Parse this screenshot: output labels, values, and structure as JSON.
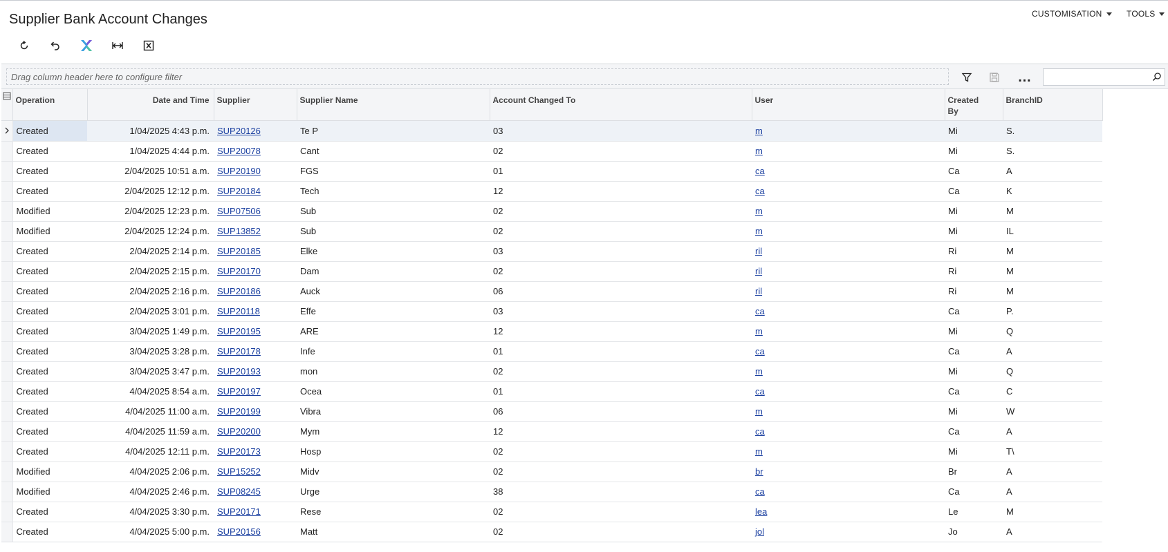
{
  "page": {
    "title": "Supplier Bank Account Changes",
    "menus": [
      {
        "label": "CUSTOMISATION"
      },
      {
        "label": "TOOLS"
      }
    ]
  },
  "toolbar": {
    "buttons": [
      {
        "icon": "refresh-icon"
      },
      {
        "icon": "undo-icon"
      },
      {
        "icon": "fit-columns-icon"
      },
      {
        "icon": "column-width-icon"
      },
      {
        "icon": "export-excel-icon"
      }
    ]
  },
  "filter": {
    "placeholder": "Drag column header here to configure filter",
    "search_value": ""
  },
  "grid": {
    "columns": [
      {
        "key": "operation",
        "label": "Operation"
      },
      {
        "key": "datetime",
        "label": "Date and Time"
      },
      {
        "key": "supplier",
        "label": "Supplier"
      },
      {
        "key": "supplier_name",
        "label": "Supplier Name"
      },
      {
        "key": "account",
        "label": "Account Changed To"
      },
      {
        "key": "user",
        "label": "User"
      },
      {
        "key": "created_by",
        "label": "Created By"
      },
      {
        "key": "branch",
        "label": "BranchID"
      }
    ],
    "rows": [
      {
        "operation": "Created",
        "datetime": "1/04/2025 4:43 p.m.",
        "supplier": "SUP20126",
        "supplier_name": "Te P",
        "account": "03",
        "user": "m",
        "created_by": "Mi",
        "branch": "S."
      },
      {
        "operation": "Created",
        "datetime": "1/04/2025 4:44 p.m.",
        "supplier": "SUP20078",
        "supplier_name": "Cant",
        "account": "02",
        "user": "m",
        "created_by": "Mi",
        "branch": "S."
      },
      {
        "operation": "Created",
        "datetime": "2/04/2025 10:51 a.m.",
        "supplier": "SUP20190",
        "supplier_name": "FGS",
        "account": "01",
        "user": "ca",
        "created_by": "Ca",
        "branch": "A"
      },
      {
        "operation": "Created",
        "datetime": "2/04/2025 12:12 p.m.",
        "supplier": "SUP20184",
        "supplier_name": "Tech",
        "account": "12",
        "user": "ca",
        "created_by": "Ca",
        "branch": "K"
      },
      {
        "operation": "Modified",
        "datetime": "2/04/2025 12:23 p.m.",
        "supplier": "SUP07506",
        "supplier_name": "Sub",
        "account": "02",
        "user": "m",
        "created_by": "Mi",
        "branch": "M"
      },
      {
        "operation": "Modified",
        "datetime": "2/04/2025 12:24 p.m.",
        "supplier": "SUP13852",
        "supplier_name": "Sub",
        "account": "02",
        "user": "m",
        "created_by": "Mi",
        "branch": "IL"
      },
      {
        "operation": "Created",
        "datetime": "2/04/2025 2:14 p.m.",
        "supplier": "SUP20185",
        "supplier_name": "Elke",
        "account": "03",
        "user": "ril",
        "created_by": "Ri",
        "branch": "M"
      },
      {
        "operation": "Created",
        "datetime": "2/04/2025 2:15 p.m.",
        "supplier": "SUP20170",
        "supplier_name": "Dam",
        "account": "02",
        "user": "ril",
        "created_by": "Ri",
        "branch": "M"
      },
      {
        "operation": "Created",
        "datetime": "2/04/2025 2:16 p.m.",
        "supplier": "SUP20186",
        "supplier_name": "Auck",
        "account": "06",
        "user": "ril",
        "created_by": "Ri",
        "branch": "M"
      },
      {
        "operation": "Created",
        "datetime": "2/04/2025 3:01 p.m.",
        "supplier": "SUP20118",
        "supplier_name": "Effe",
        "account": "03",
        "user": "ca",
        "created_by": "Ca",
        "branch": "P."
      },
      {
        "operation": "Created",
        "datetime": "3/04/2025 1:49 p.m.",
        "supplier": "SUP20195",
        "supplier_name": "ARE",
        "account": "12",
        "user": "m",
        "created_by": "Mi",
        "branch": "Q"
      },
      {
        "operation": "Created",
        "datetime": "3/04/2025 3:28 p.m.",
        "supplier": "SUP20178",
        "supplier_name": "Infe",
        "account": "01",
        "user": "ca",
        "created_by": "Ca",
        "branch": "A"
      },
      {
        "operation": "Created",
        "datetime": "3/04/2025 3:47 p.m.",
        "supplier": "SUP20193",
        "supplier_name": "mon",
        "account": "02",
        "user": "m",
        "created_by": "Mi",
        "branch": "Q"
      },
      {
        "operation": "Created",
        "datetime": "4/04/2025 8:54 a.m.",
        "supplier": "SUP20197",
        "supplier_name": "Ocea",
        "account": "01",
        "user": "ca",
        "created_by": "Ca",
        "branch": "C"
      },
      {
        "operation": "Created",
        "datetime": "4/04/2025 11:00 a.m.",
        "supplier": "SUP20199",
        "supplier_name": "Vibra",
        "account": "06",
        "user": "m",
        "created_by": "Mi",
        "branch": "W"
      },
      {
        "operation": "Created",
        "datetime": "4/04/2025 11:59 a.m.",
        "supplier": "SUP20200",
        "supplier_name": "Mym",
        "account": "12",
        "user": "ca",
        "created_by": "Ca",
        "branch": "A"
      },
      {
        "operation": "Created",
        "datetime": "4/04/2025 12:11 p.m.",
        "supplier": "SUP20173",
        "supplier_name": "Hosp",
        "account": "02",
        "user": "m",
        "created_by": "Mi",
        "branch": "T\\"
      },
      {
        "operation": "Modified",
        "datetime": "4/04/2025 2:06 p.m.",
        "supplier": "SUP15252",
        "supplier_name": "Midv",
        "account": "02",
        "user": "br",
        "created_by": "Br",
        "branch": "A"
      },
      {
        "operation": "Modified",
        "datetime": "4/04/2025 2:46 p.m.",
        "supplier": "SUP08245",
        "supplier_name": "Urge",
        "account": "38",
        "user": "ca",
        "created_by": "Ca",
        "branch": "A"
      },
      {
        "operation": "Created",
        "datetime": "4/04/2025 3:30 p.m.",
        "supplier": "SUP20171",
        "supplier_name": "Rese",
        "account": "02",
        "user": "lea",
        "created_by": "Le",
        "branch": "M"
      },
      {
        "operation": "Created",
        "datetime": "4/04/2025 5:00 p.m.",
        "supplier": "SUP20156",
        "supplier_name": "Matt",
        "account": "02",
        "user": "jol",
        "created_by": "Jo",
        "branch": "A"
      }
    ]
  }
}
